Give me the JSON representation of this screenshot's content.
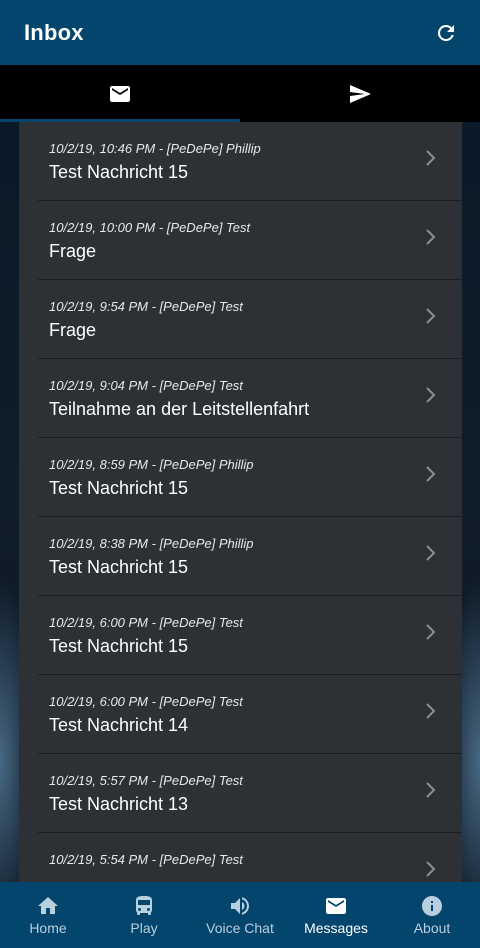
{
  "header": {
    "title": "Inbox",
    "refresh_icon": "refresh-icon"
  },
  "tabs": [
    {
      "icon": "mail-icon",
      "active": true
    },
    {
      "icon": "send-icon",
      "active": false
    }
  ],
  "messages": [
    {
      "meta": "10/2/19, 10:46 PM - [PeDePe] Phillip",
      "subject": "Test Nachricht 15"
    },
    {
      "meta": "10/2/19, 10:00 PM - [PeDePe] Test",
      "subject": "Frage"
    },
    {
      "meta": "10/2/19, 9:54 PM - [PeDePe] Test",
      "subject": "Frage"
    },
    {
      "meta": "10/2/19, 9:04 PM - [PeDePe] Test",
      "subject": "Teilnahme an der Leitstellenfahrt"
    },
    {
      "meta": "10/2/19, 8:59 PM - [PeDePe] Phillip",
      "subject": "Test Nachricht 15"
    },
    {
      "meta": "10/2/19, 8:38 PM - [PeDePe] Phillip",
      "subject": "Test Nachricht 15"
    },
    {
      "meta": "10/2/19, 6:00 PM - [PeDePe] Test",
      "subject": "Test Nachricht 15"
    },
    {
      "meta": "10/2/19, 6:00 PM - [PeDePe] Test",
      "subject": "Test Nachricht 14"
    },
    {
      "meta": "10/2/19, 5:57 PM - [PeDePe] Test",
      "subject": "Test Nachricht 13"
    },
    {
      "meta": "10/2/19, 5:54 PM - [PeDePe] Test",
      "subject": ""
    }
  ],
  "bottom_nav": [
    {
      "label": "Home",
      "icon": "home-icon",
      "active": false
    },
    {
      "label": "Play",
      "icon": "bus-icon",
      "active": false
    },
    {
      "label": "Voice Chat",
      "icon": "speaker-icon",
      "active": false
    },
    {
      "label": "Messages",
      "icon": "mail-icon",
      "active": true
    },
    {
      "label": "About",
      "icon": "info-icon",
      "active": false
    }
  ],
  "colors": {
    "primary": "#03456c",
    "list_bg": "#2d3135",
    "tab_bg": "#000000"
  }
}
